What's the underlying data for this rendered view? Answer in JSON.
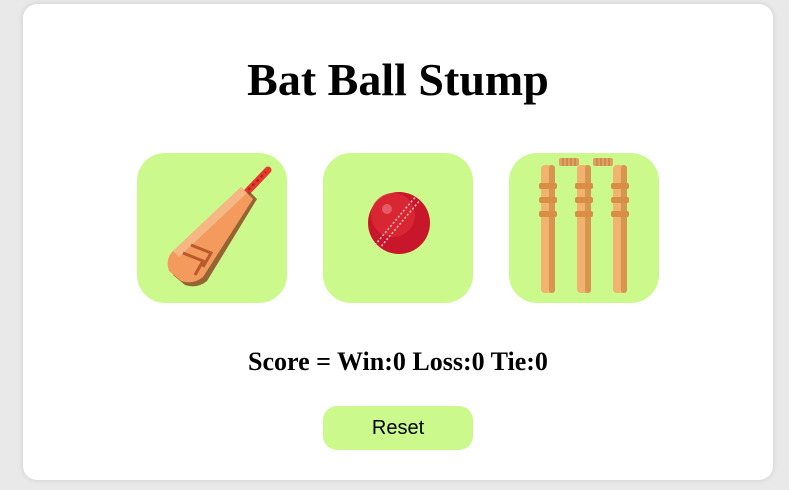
{
  "app": {
    "title": "Bat Ball Stump"
  },
  "choices": [
    {
      "name": "Bat",
      "icon": "cricket-bat-icon"
    },
    {
      "name": "Ball",
      "icon": "cricket-ball-icon"
    },
    {
      "name": "Stump",
      "icon": "cricket-stumps-icon"
    }
  ],
  "score": {
    "text": "Score = Win:0 Loss:0 Tie:0"
  },
  "reset": {
    "label": "Reset"
  },
  "colors": {
    "accent": "#ccf98b",
    "card": "#ffffff",
    "background": "#e9e9e9"
  }
}
